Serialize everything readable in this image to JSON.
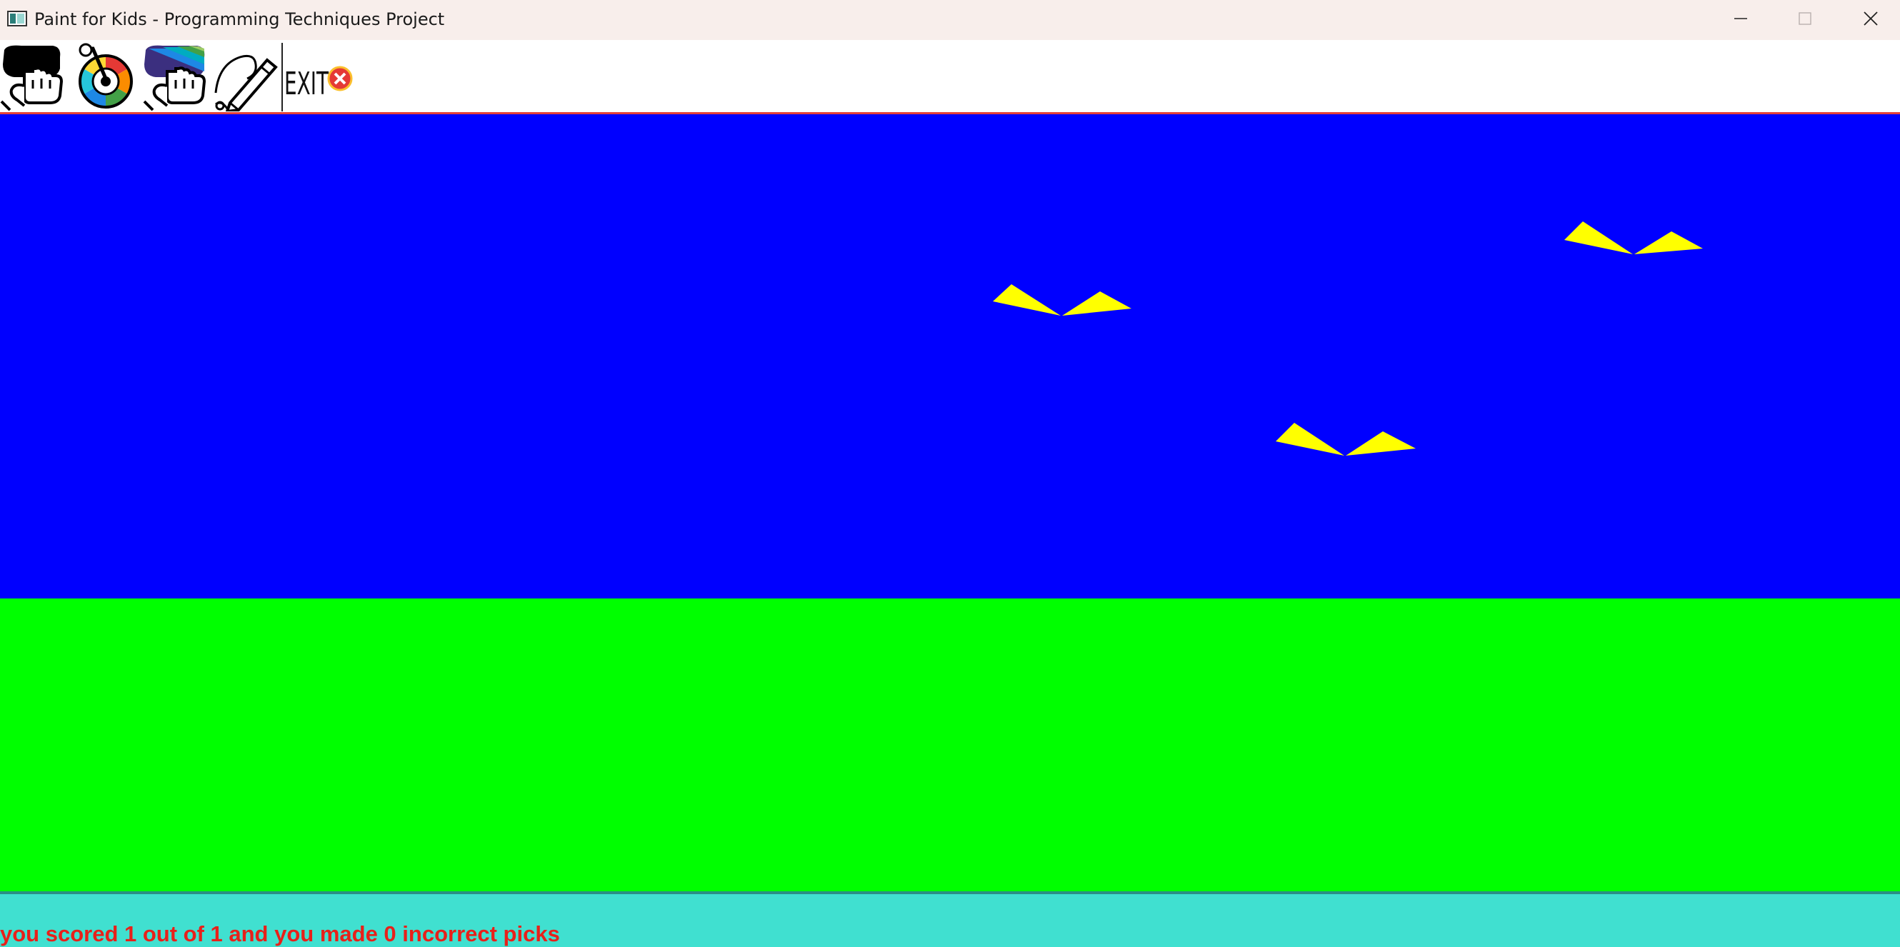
{
  "window": {
    "title": "Paint for Kids - Programming Techniques Project",
    "controls": {
      "minimize_icon": "minimize-icon",
      "maximize_icon": "maximize-icon",
      "close_icon": "close-icon"
    }
  },
  "toolbar": {
    "tools": [
      {
        "name": "pick-by-shape-tool",
        "icon": "hand-pointer-shape-icon"
      },
      {
        "name": "pick-by-color-tool",
        "icon": "color-wheel-icon"
      },
      {
        "name": "pick-by-shape-and-color-tool",
        "icon": "hand-pointer-rainbow-icon"
      },
      {
        "name": "switch-to-draw-mode-tool",
        "icon": "pencil-icon"
      },
      {
        "name": "exit-tool",
        "label": "EXIT",
        "icon": "exit-x-icon"
      }
    ]
  },
  "canvas": {
    "colors": {
      "sky": "#0000FF",
      "ground": "#00FF00",
      "shape_fill": "#FFFF00"
    },
    "shapes": [
      {
        "type": "triangle-pair",
        "color": "yellow"
      },
      {
        "type": "triangle-pair",
        "color": "yellow"
      },
      {
        "type": "triangle-pair",
        "color": "yellow"
      }
    ]
  },
  "status": {
    "message": "you scored 1 out of 1 and you made 0 incorrect picks",
    "text_color": "#E8201A",
    "background": "#40E0D0"
  }
}
